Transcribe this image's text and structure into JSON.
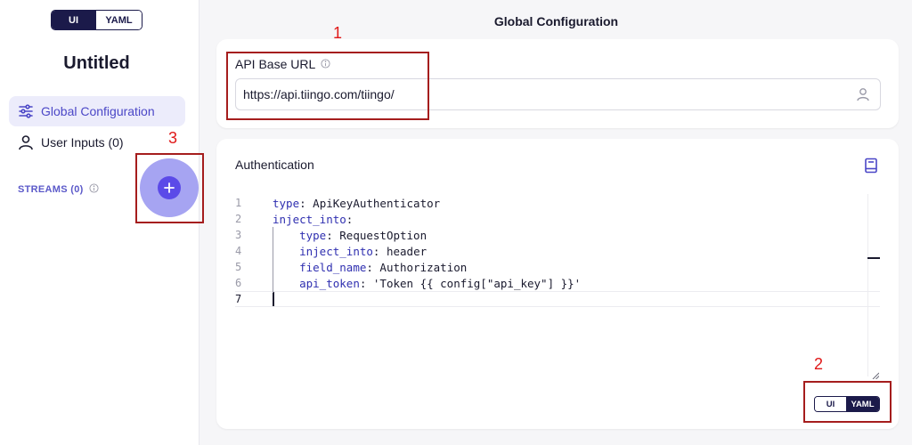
{
  "sidebar": {
    "mode_toggle": {
      "ui_label": "UI",
      "yaml_label": "YAML",
      "active": "UI"
    },
    "project_title": "Untitled",
    "nav": [
      {
        "label": "Global Configuration",
        "icon": "sliders-icon",
        "active": true
      },
      {
        "label": "User Inputs (0)",
        "icon": "user-icon",
        "active": false
      }
    ],
    "streams_label": "STREAMS (0)",
    "add_stream_icon": "plus-icon"
  },
  "main": {
    "title": "Global Configuration",
    "api_base_url": {
      "label": "API Base URL",
      "value": "https://api.tiingo.com/tiingo/"
    },
    "authentication": {
      "title": "Authentication",
      "editor_lines": [
        {
          "num": "1",
          "key": "type",
          "value": " ApiKeyAuthenticator",
          "indent": ""
        },
        {
          "num": "2",
          "key": "inject_into",
          "value": "",
          "indent": ""
        },
        {
          "num": "3",
          "key": "type",
          "value": " RequestOption",
          "indent": "    "
        },
        {
          "num": "4",
          "key": "inject_into",
          "value": " header",
          "indent": "    "
        },
        {
          "num": "5",
          "key": "field_name",
          "value": " Authorization",
          "indent": "    "
        },
        {
          "num": "6",
          "key": "api_token",
          "value": " 'Token {{ config[\"api_key\"] }}'",
          "indent": "    "
        },
        {
          "num": "7",
          "key": "",
          "value": "",
          "indent": ""
        }
      ],
      "mode_toggle": {
        "ui_label": "UI",
        "yaml_label": "YAML",
        "active": "YAML"
      }
    }
  },
  "annotations": [
    "1",
    "2",
    "3"
  ],
  "colors": {
    "accent": "#4b47c7",
    "dark_navy": "#1b1a4a",
    "annotation_red": "#a51d1d"
  }
}
